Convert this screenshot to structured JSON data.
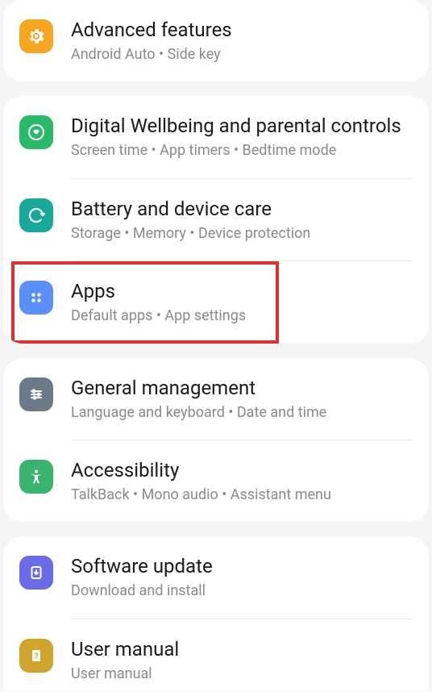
{
  "groups": [
    {
      "items": [
        {
          "icon": "gear-plus-icon",
          "iconClass": "ic-orange",
          "title": "Advanced features",
          "subtitle": "Android Auto  •  Side key"
        }
      ]
    },
    {
      "items": [
        {
          "icon": "heart-icon",
          "iconClass": "ic-green1",
          "title": "Digital Wellbeing and parental controls",
          "subtitle": "Screen time  •  App timers  •  Bedtime mode"
        },
        {
          "icon": "refresh-icon",
          "iconClass": "ic-teal",
          "title": "Battery and device care",
          "subtitle": "Storage  •  Memory  •  Device protection"
        },
        {
          "icon": "apps-grid-icon",
          "iconClass": "ic-blue",
          "title": "Apps",
          "subtitle": "Default apps  •  App settings",
          "highlighted": true
        }
      ]
    },
    {
      "items": [
        {
          "icon": "sliders-icon",
          "iconClass": "ic-grey",
          "title": "General management",
          "subtitle": "Language and keyboard  •  Date and time"
        },
        {
          "icon": "accessibility-icon",
          "iconClass": "ic-green2",
          "title": "Accessibility",
          "subtitle": "TalkBack  •  Mono audio  •  Assistant menu"
        }
      ]
    },
    {
      "items": [
        {
          "icon": "download-icon",
          "iconClass": "ic-purple",
          "title": "Software update",
          "subtitle": "Download and install"
        },
        {
          "icon": "question-book-icon",
          "iconClass": "ic-olive",
          "title": "User manual",
          "subtitle": "User manual"
        }
      ]
    }
  ]
}
